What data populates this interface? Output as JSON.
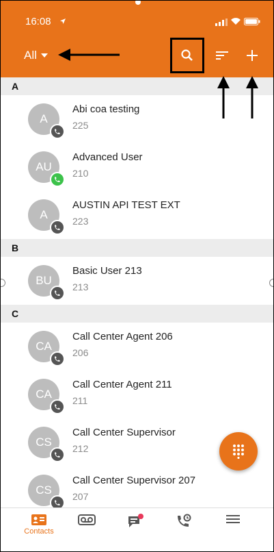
{
  "status_bar": {
    "time": "16:08"
  },
  "header": {
    "filter_label": "All",
    "icons": [
      "location-arrow-icon",
      "signal-icon",
      "wifi-icon",
      "battery-icon",
      "chevron-down-icon",
      "search-icon",
      "sort-icon",
      "plus-icon"
    ]
  },
  "sections": [
    {
      "letter": "A",
      "contacts": [
        {
          "initials": "A",
          "name": "Abi coa testing",
          "ext": "225",
          "presence": "offline"
        },
        {
          "initials": "AU",
          "name": "Advanced User",
          "ext": "210",
          "presence": "available"
        },
        {
          "initials": "A",
          "name": "AUSTIN API TEST EXT",
          "ext": "223",
          "presence": "offline"
        }
      ]
    },
    {
      "letter": "B",
      "contacts": [
        {
          "initials": "BU",
          "name": "Basic User 213",
          "ext": "213",
          "presence": "offline"
        }
      ]
    },
    {
      "letter": "C",
      "contacts": [
        {
          "initials": "CA",
          "name": "Call Center Agent 206",
          "ext": "206",
          "presence": "offline"
        },
        {
          "initials": "CA",
          "name": "Call Center Agent 211",
          "ext": "211",
          "presence": "offline"
        },
        {
          "initials": "CS",
          "name": "Call Center Supervisor",
          "ext": "212",
          "presence": "offline"
        },
        {
          "initials": "CS",
          "name": "Call Center Supervisor 207",
          "ext": "207",
          "presence": "offline"
        }
      ]
    }
  ],
  "tabs": [
    {
      "label": "Contacts",
      "icon": "contacts-icon",
      "active": true
    },
    {
      "label": "",
      "icon": "voicemail-icon",
      "active": false
    },
    {
      "label": "",
      "icon": "chat-icon",
      "active": false
    },
    {
      "label": "",
      "icon": "call-history-icon",
      "active": false
    },
    {
      "label": "",
      "icon": "menu-icon",
      "active": false
    }
  ],
  "colors": {
    "accent": "#e8731a",
    "avatar": "#bdbdbd",
    "available": "#3cc24a",
    "offline": "#555555",
    "section": "#ececec"
  }
}
